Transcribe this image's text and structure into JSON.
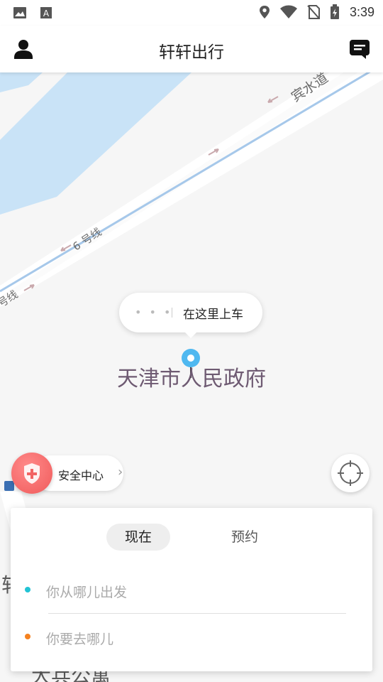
{
  "status_bar": {
    "time": "3:39",
    "icons": [
      "image-icon",
      "font-a-icon",
      "location-icon",
      "wifi-icon",
      "no-sim-icon",
      "battery-charging-icon"
    ]
  },
  "header": {
    "title": "轩轩出行",
    "left_icon": "user-icon",
    "right_icon": "message-icon"
  },
  "map": {
    "street_labels": [
      "宾水道",
      "6 号线",
      "号线"
    ],
    "bottom_labels": [
      "轩",
      "大兵公寓"
    ],
    "pickup_hint": "在这里上车",
    "pickup_dots": "• • •",
    "place_name": "天津市人民政府",
    "colors": {
      "water": "#c9e3f7",
      "road": "#ffffff",
      "route_line": "#a6c8ea",
      "pin": "#4fb8f0",
      "place_text": "#6e5a72"
    }
  },
  "safety_center": {
    "label": "安全中心",
    "icon": "shield-plus-icon",
    "chevron": "›"
  },
  "locate_button": {
    "icon": "crosshair-icon"
  },
  "booking_card": {
    "tabs": [
      {
        "label": "现在",
        "selected": true
      },
      {
        "label": "预约",
        "selected": false
      }
    ],
    "from_placeholder": "你从哪儿出发",
    "to_placeholder": "你要去哪儿",
    "from_dot_color": "#22c3d4",
    "to_dot_color": "#f58220"
  }
}
